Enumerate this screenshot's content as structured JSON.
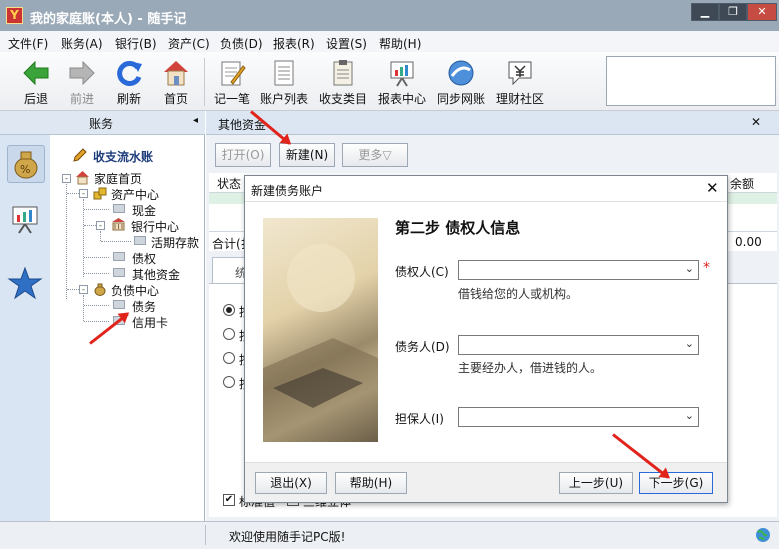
{
  "window": {
    "title": "我的家庭账(本人) - 随手记",
    "app_icon_char": "Y",
    "min_glyph": "▁",
    "max_glyph": "❐",
    "close_glyph": "✕"
  },
  "menu": [
    "文件(F)",
    "账务(A)",
    "银行(B)",
    "资产(C)",
    "负债(D)",
    "报表(R)",
    "设置(S)",
    "帮助(H)"
  ],
  "toolbar": {
    "back": "后退",
    "forward": "前进",
    "refresh": "刷新",
    "home": "首页",
    "record": "记一笔",
    "account_list": "账户列表",
    "categories": "收支类目",
    "reports": "报表中心",
    "sync": "同步网账",
    "community": "理财社区"
  },
  "left": {
    "header": "账务",
    "collapse": "◂",
    "record_flow": "收支流水账",
    "tree": {
      "home": "家庭首页",
      "assets": "资产中心",
      "cash": "现金",
      "bank": "银行中心",
      "deposit": "活期存款",
      "claims": "债权",
      "other_funds": "其他资金",
      "liabilities": "负债中心",
      "debt": "债务",
      "credit_card": "信用卡"
    }
  },
  "right": {
    "header": "其他资金",
    "close": "✕",
    "buttons": {
      "open": "打开(O)",
      "new": "新建(N)",
      "more": "更多▽"
    },
    "col_status": "状态",
    "col_balance": "余额",
    "total_label": "合计(扌",
    "total_value": "0.00",
    "tab_partial": "统",
    "radio_partial": [
      "按",
      "按",
      "按",
      "按"
    ],
    "check_label_1": "标准值",
    "check_label_2": "三维立体"
  },
  "dialog": {
    "title": "新建债务账户",
    "close": "✕",
    "heading": "第二步  债权人信息",
    "creditor_label": "债权人(C)",
    "creditor_hint": "借钱给您的人或机构。",
    "required_mark": "*",
    "debtor_label": "债务人(D)",
    "debtor_hint": "主要经办人，借进钱的人。",
    "guarantor_label": "担保人(I)",
    "chevron": "⌄",
    "buttons": {
      "exit": "退出(X)",
      "help": "帮助(H)",
      "prev": "上一步(U)",
      "next": "下一步(G)"
    }
  },
  "status": {
    "message": "欢迎使用随手记PC版!"
  },
  "colors": {
    "accent": "#2a6ad8",
    "annotation_arrow": "#e0241b",
    "titlebar": "#9aa9b8"
  }
}
